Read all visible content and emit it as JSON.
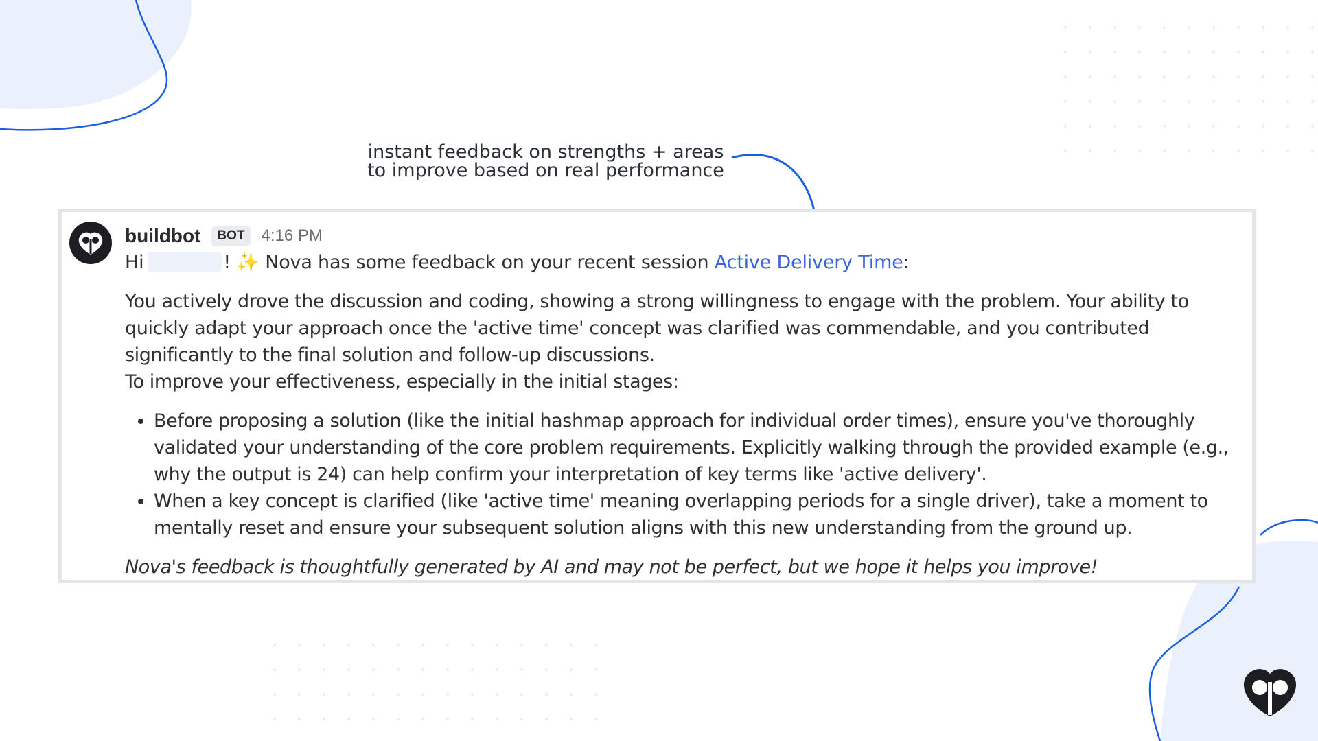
{
  "annotation": {
    "line1": "instant feedback on strengths + areas",
    "line2": "to improve based on real performance"
  },
  "message": {
    "username": "buildbot",
    "badge": "BOT",
    "timestamp": "4:16 PM",
    "greeting_prefix": "Hi",
    "greeting_after_name": "!",
    "sparkle": "✨",
    "greeting_text": " Nova has some feedback on your recent session ",
    "session_link": "Active Delivery Time",
    "greeting_suffix": ":",
    "paragraph1": "You actively drove the discussion and coding, showing a strong willingness to engage with the problem. Your ability to quickly adapt your approach once the 'active time' concept was clarified was commendable, and you contributed significantly to the final solution and follow-up discussions.",
    "paragraph2": "To improve your effectiveness, especially in the initial stages:",
    "bullets": [
      "Before proposing a solution (like the initial hashmap approach for individual order times), ensure you've thoroughly validated your understanding of the core problem requirements. Explicitly walking through the provided example (e.g., why the output is 24) can help confirm your interpretation of key terms like 'active delivery'.",
      "When a key concept is clarified (like 'active time' meaning overlapping periods for a single driver), take a moment to mentally reset and ensure your subsequent solution aligns with this new understanding from the ground up."
    ],
    "disclaimer": "Nova's feedback is thoughtfully generated by AI and may not be perfect, but we hope it helps you improve!"
  },
  "colors": {
    "link": "#3b64d9",
    "accent_line": "#1a5fe0",
    "blob": "#eaf1fd",
    "avatar_bg": "#1c1e21"
  },
  "icons": {
    "avatar": "owl-logo-icon",
    "corner": "owl-logo-icon",
    "arrow": "curved-arrow-icon"
  }
}
